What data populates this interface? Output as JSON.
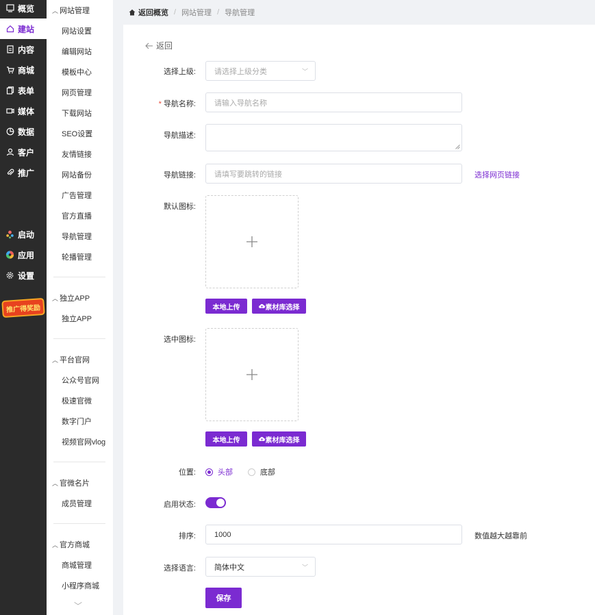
{
  "rail": {
    "items": [
      {
        "label": "概览",
        "icon": "overview-icon"
      },
      {
        "label": "建站",
        "icon": "home-icon"
      },
      {
        "label": "内容",
        "icon": "document-icon"
      },
      {
        "label": "商城",
        "icon": "cart-icon"
      },
      {
        "label": "表单",
        "icon": "form-icon"
      },
      {
        "label": "媒体",
        "icon": "video-icon"
      },
      {
        "label": "数据",
        "icon": "chart-icon"
      },
      {
        "label": "客户",
        "icon": "user-icon"
      },
      {
        "label": "推广",
        "icon": "paperclip-icon"
      }
    ],
    "apps": [
      {
        "label": "启动",
        "icon": "launch-icon"
      },
      {
        "label": "应用",
        "icon": "apps-icon"
      },
      {
        "label": "设置",
        "icon": "gear-icon"
      }
    ],
    "promo": "推广得奖励",
    "active_index": 1
  },
  "subnav": {
    "groups": [
      {
        "title": "网站管理",
        "items": [
          "网站设置",
          "编辑网站",
          "模板中心",
          "网页管理",
          "下载网站",
          "SEO设置",
          "友情链接",
          "网站备份",
          "广告管理",
          "官方直播",
          "导航管理",
          "轮播管理"
        ]
      },
      {
        "title": "独立APP",
        "items": [
          "独立APP"
        ]
      },
      {
        "title": "平台官网",
        "items": [
          "公众号官网",
          "极速官微",
          "数字门户",
          "视频官网vlog"
        ]
      },
      {
        "title": "官微名片",
        "items": [
          "成员管理"
        ]
      },
      {
        "title": "官方商城",
        "items": [
          "商城管理",
          "小程序商城"
        ]
      }
    ]
  },
  "breadcrumb": {
    "home": "返回概览",
    "level1": "网站管理",
    "level2": "导航管理"
  },
  "form": {
    "back": "返回",
    "parent": {
      "label": "选择上级:",
      "placeholder": "请选择上级分类"
    },
    "name": {
      "label": "导航名称:",
      "required_mark": "*",
      "placeholder": "请输入导航名称"
    },
    "desc": {
      "label": "导航描述:"
    },
    "link": {
      "label": "导航链接:",
      "placeholder": "请填写要跳转的链接",
      "action": "选择网页链接"
    },
    "default_icon": {
      "label": "默认图标:",
      "upload_local": "本地上传",
      "upload_library": "素材库选择"
    },
    "selected_icon": {
      "label": "选中图标:",
      "upload_local": "本地上传",
      "upload_library": "素材库选择"
    },
    "position": {
      "label": "位置:",
      "options": [
        "头部",
        "底部"
      ],
      "selected": "头部"
    },
    "enabled": {
      "label": "启用状态:",
      "value": true
    },
    "sort": {
      "label": "排序:",
      "value": "1000",
      "tip": "数值越大越靠前"
    },
    "language": {
      "label": "选择语言:",
      "value": "简体中文"
    },
    "save": "保存"
  },
  "colors": {
    "accent": "#7b2bd1",
    "rail_bg": "#2b2b2b",
    "required": "#e84b3c"
  }
}
